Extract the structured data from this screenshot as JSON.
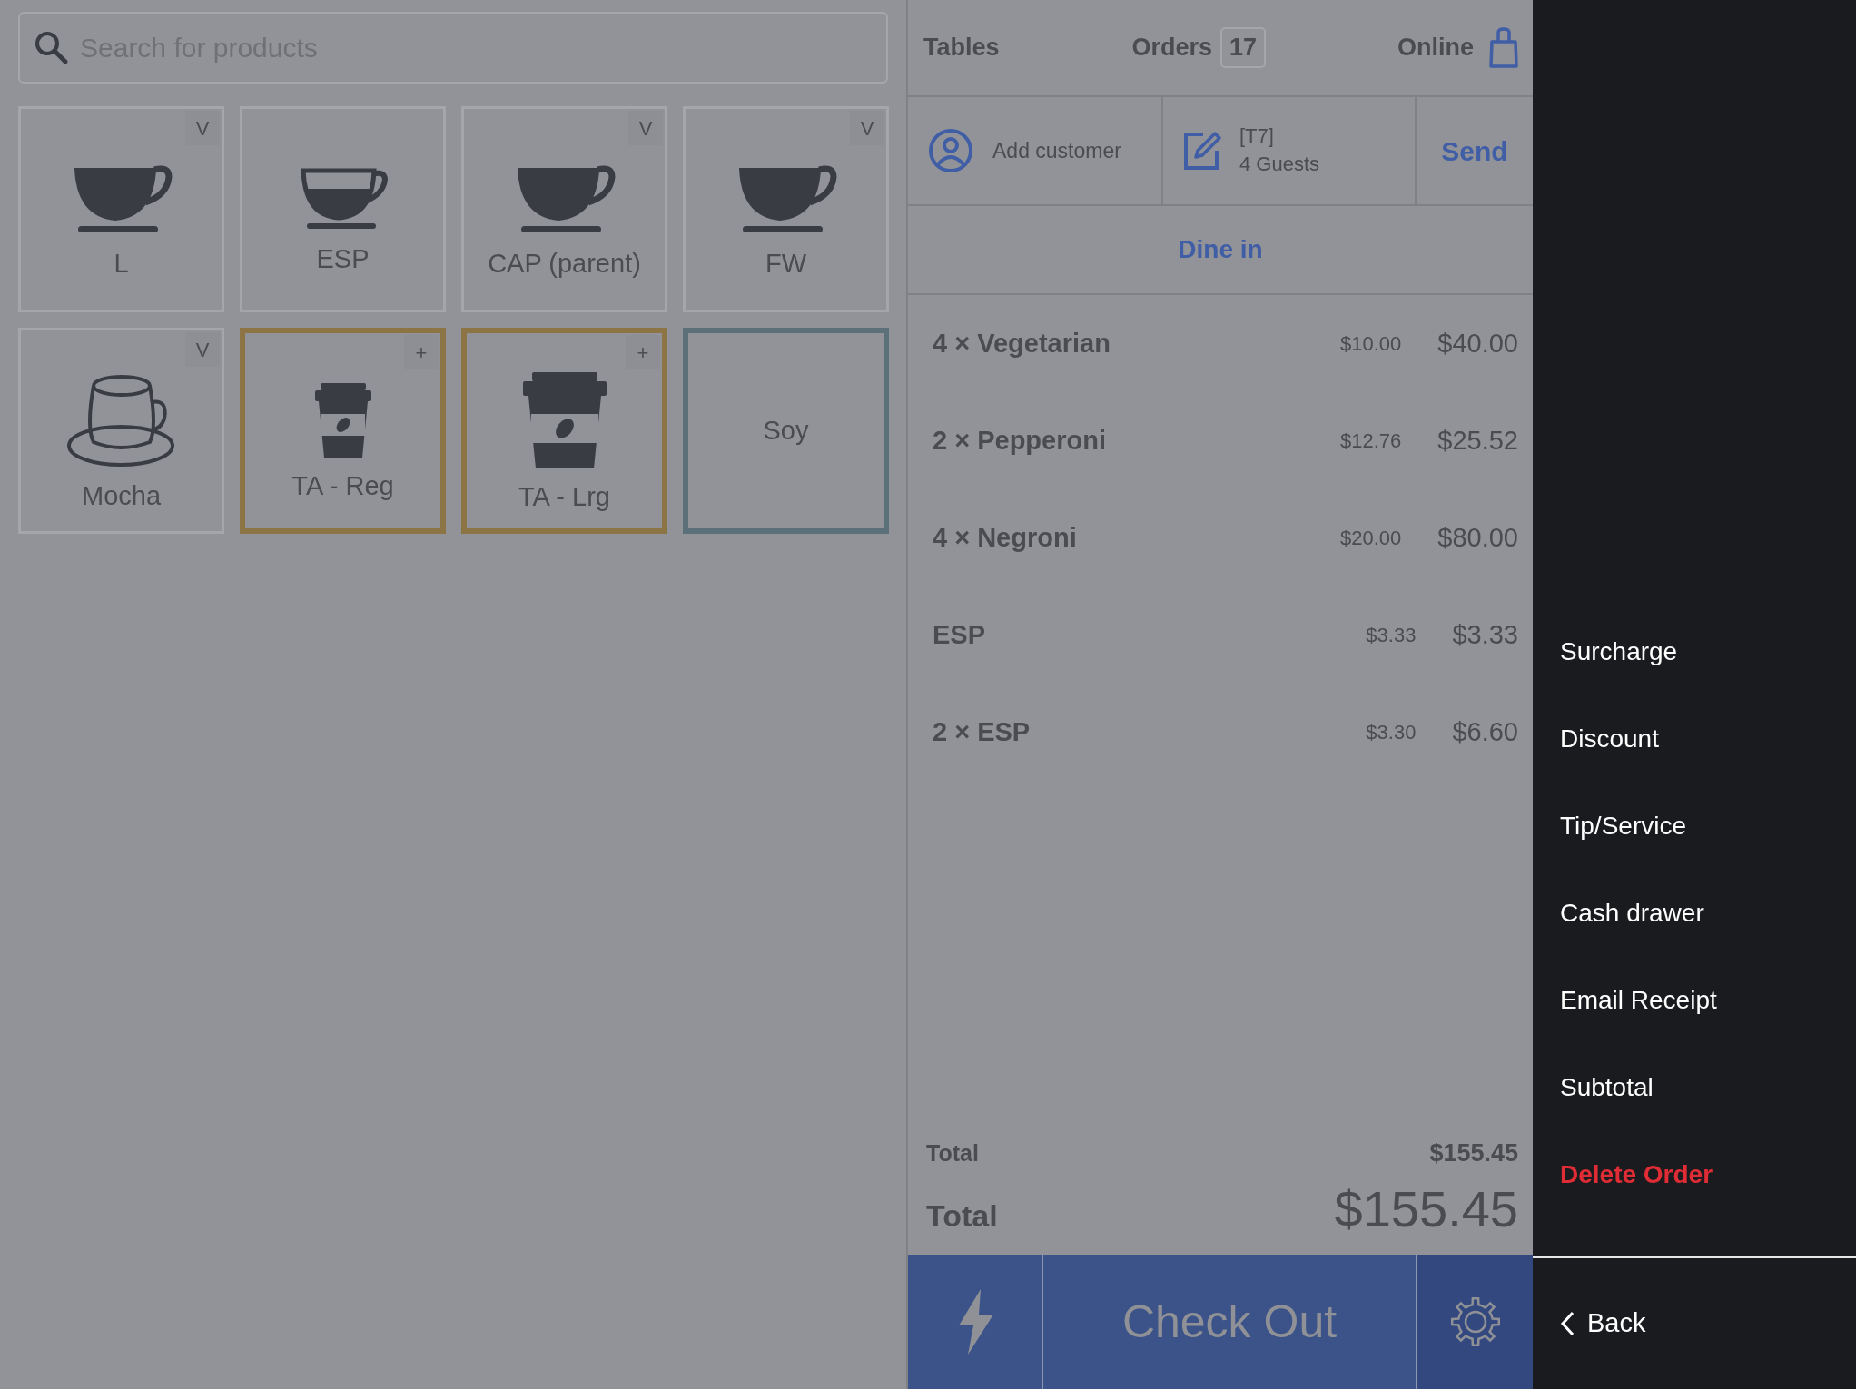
{
  "search": {
    "placeholder": "Search for products"
  },
  "products": [
    {
      "label": "L",
      "kind": "cup",
      "corner": "V",
      "color": "#a4a6ab"
    },
    {
      "label": "ESP",
      "kind": "espresso",
      "color": "#a4a6ab"
    },
    {
      "label": "CAP (parent)",
      "kind": "cup",
      "corner": "V",
      "color": "#a4a6ab"
    },
    {
      "label": "FW",
      "kind": "cup",
      "corner": "V",
      "color": "#a4a6ab"
    },
    {
      "label": "Mocha",
      "kind": "saucer",
      "corner": "V",
      "color": "#a4a6ab"
    },
    {
      "label": "TA - Reg",
      "kind": "takeaway",
      "corner": "+",
      "color": "#8c7444"
    },
    {
      "label": "TA - Lrg",
      "kind": "takeaway",
      "corner": "+",
      "color": "#8c7444"
    },
    {
      "label": "Soy",
      "kind": "plain",
      "color": "#5b7079"
    }
  ],
  "header": {
    "tables": "Tables",
    "orders": "Orders",
    "orders_count": "17",
    "online": "Online"
  },
  "order": {
    "customer": "Add customer",
    "table": "[T7]",
    "guests": "4 Guests",
    "send": "Send",
    "mode": "Dine in"
  },
  "items": [
    {
      "name": "4 × Vegetarian",
      "unit": "$10.00",
      "total": "$40.00"
    },
    {
      "name": "2 × Pepperoni",
      "unit": "$12.76",
      "total": "$25.52"
    },
    {
      "name": "4 × Negroni",
      "unit": "$20.00",
      "total": "$80.00"
    },
    {
      "name": "ESP",
      "unit": "$3.33",
      "total": "$3.33"
    },
    {
      "name": "2 × ESP",
      "unit": "$3.30",
      "total": "$6.60"
    }
  ],
  "totals": [
    {
      "label": "Total",
      "value": "$155.45",
      "kind": "small"
    },
    {
      "label": "Total",
      "value": "$155.45",
      "kind": "large"
    }
  ],
  "checkout": "Check Out",
  "menu": [
    {
      "label": "Surcharge",
      "kind": "action"
    },
    {
      "label": "Discount",
      "kind": "action"
    },
    {
      "label": "Tip/Service",
      "kind": "action"
    },
    {
      "label": "Cash drawer",
      "kind": "action"
    },
    {
      "label": "Email Receipt",
      "kind": "action"
    },
    {
      "label": "Subtotal",
      "kind": "action"
    },
    {
      "label": "Delete Order",
      "kind": "danger"
    }
  ],
  "back": "Back"
}
